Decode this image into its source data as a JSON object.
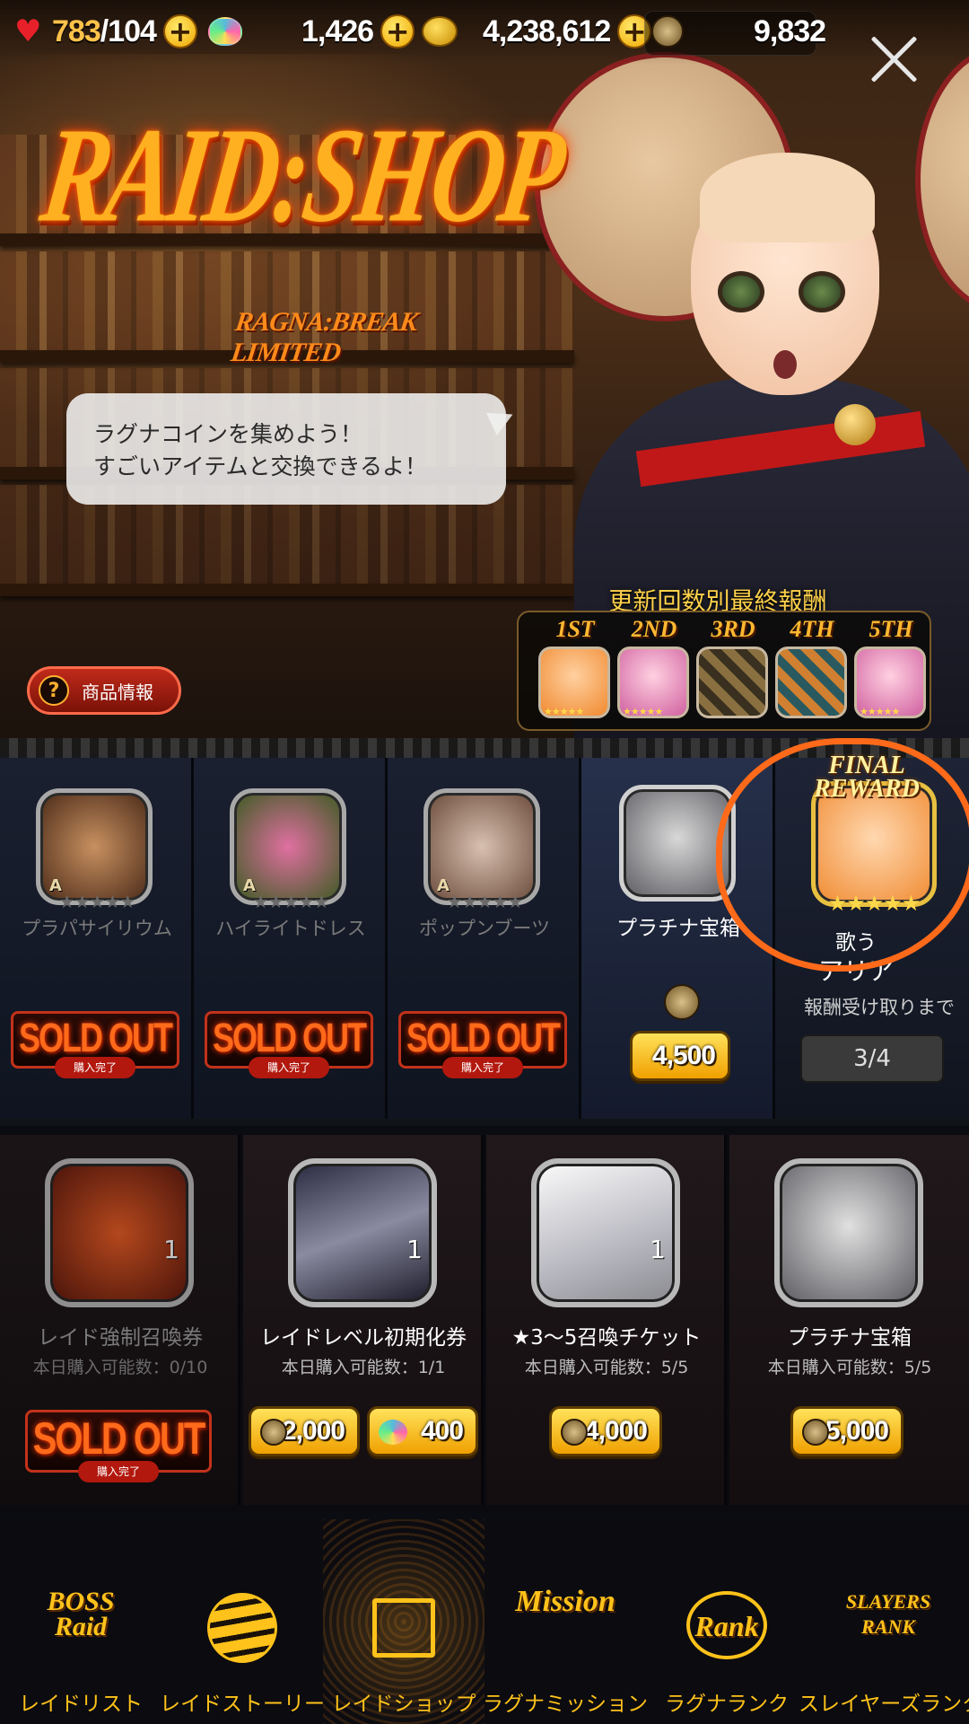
{
  "topbar": {
    "stamina": "783",
    "stamina_max": "/104",
    "gems": "1,426",
    "gold": "4,238,612",
    "ragna_coins": "9,832",
    "plus_symbol": "+",
    "icons": [
      "heart-icon",
      "gem-icon",
      "gold-coin-icon",
      "ragna-coin-icon",
      "close-icon"
    ]
  },
  "header": {
    "logo_main": "RAID:SHOP",
    "logo_sub": "RAGNA:BREAK LIMITED",
    "bubble_line1": "ラグナコインを集めよう！",
    "bubble_line2": "すごいアイテムと交換できるよ！",
    "info_button": "商品情報",
    "info_icon": "?"
  },
  "reward_strip": {
    "title": "更新回数別最終報酬",
    "items": [
      {
        "ordinal": "1ST",
        "stars": "★★★★★",
        "color": "#f0a040"
      },
      {
        "ordinal": "2ND",
        "stars": "★★★★★",
        "color": "#e870b0"
      },
      {
        "ordinal": "3RD",
        "stars": "",
        "color": "#5a5040"
      },
      {
        "ordinal": "4TH",
        "stars": "",
        "color": "#3a6a70"
      },
      {
        "ordinal": "5TH",
        "stars": "★★★★★",
        "color": "#e870b0"
      }
    ]
  },
  "row1": {
    "items": [
      {
        "name": "プラパサイリウム",
        "rank": "A",
        "stars": "★★★★★",
        "status": "SOLD OUT",
        "status_sub": "購入完了"
      },
      {
        "name": "ハイライトドレス",
        "rank": "A",
        "stars": "★★★★★",
        "status": "SOLD OUT",
        "status_sub": "購入完了"
      },
      {
        "name": "ポップンブーツ",
        "rank": "A",
        "stars": "★★★★★",
        "status": "SOLD OUT",
        "status_sub": "購入完了"
      },
      {
        "name": "プラチナ宝箱",
        "price": "4,500"
      }
    ],
    "final_reward": {
      "tag": "FINAL REWARD",
      "stars": "★★★★★",
      "name_line1": "歌う",
      "name_line2": "アリア",
      "progress_label": "報酬受け取りまで",
      "progress": "3/4"
    }
  },
  "row2": {
    "items": [
      {
        "name": "レイド強制召喚券",
        "limit": "本日購入可能数：0/10",
        "qty": "1",
        "status": "SOLD OUT",
        "status_sub": "購入完了"
      },
      {
        "name": "レイドレベル初期化券",
        "limit": "本日購入可能数：1/1",
        "qty": "1",
        "price_coin": "2,000",
        "price_gem": "400"
      },
      {
        "name": "★3〜5召喚チケット",
        "limit": "本日購入可能数：5/5",
        "qty": "1",
        "price_coin": "4,000"
      },
      {
        "name": "プラチナ宝箱",
        "limit": "本日購入可能数：5/5",
        "price_coin": "35,000"
      }
    ]
  },
  "nav": {
    "tabs": [
      {
        "icon_text": "BOSS Raid",
        "label": "レイドリスト"
      },
      {
        "icon_text": "",
        "label": "レイドストーリー"
      },
      {
        "icon_text": "",
        "label": "レイドショップ",
        "active": true
      },
      {
        "icon_text": "Mission",
        "label": "ラグナミッション"
      },
      {
        "icon_text": "Rank",
        "label": "ラグナランク"
      },
      {
        "icon_text": "SLAYERS RANK",
        "label": "スレイヤーズランク"
      }
    ]
  },
  "colors": {
    "accent": "#ffc21a",
    "sold_out": "#ff6a1a",
    "circle": "#ff6a1a"
  }
}
